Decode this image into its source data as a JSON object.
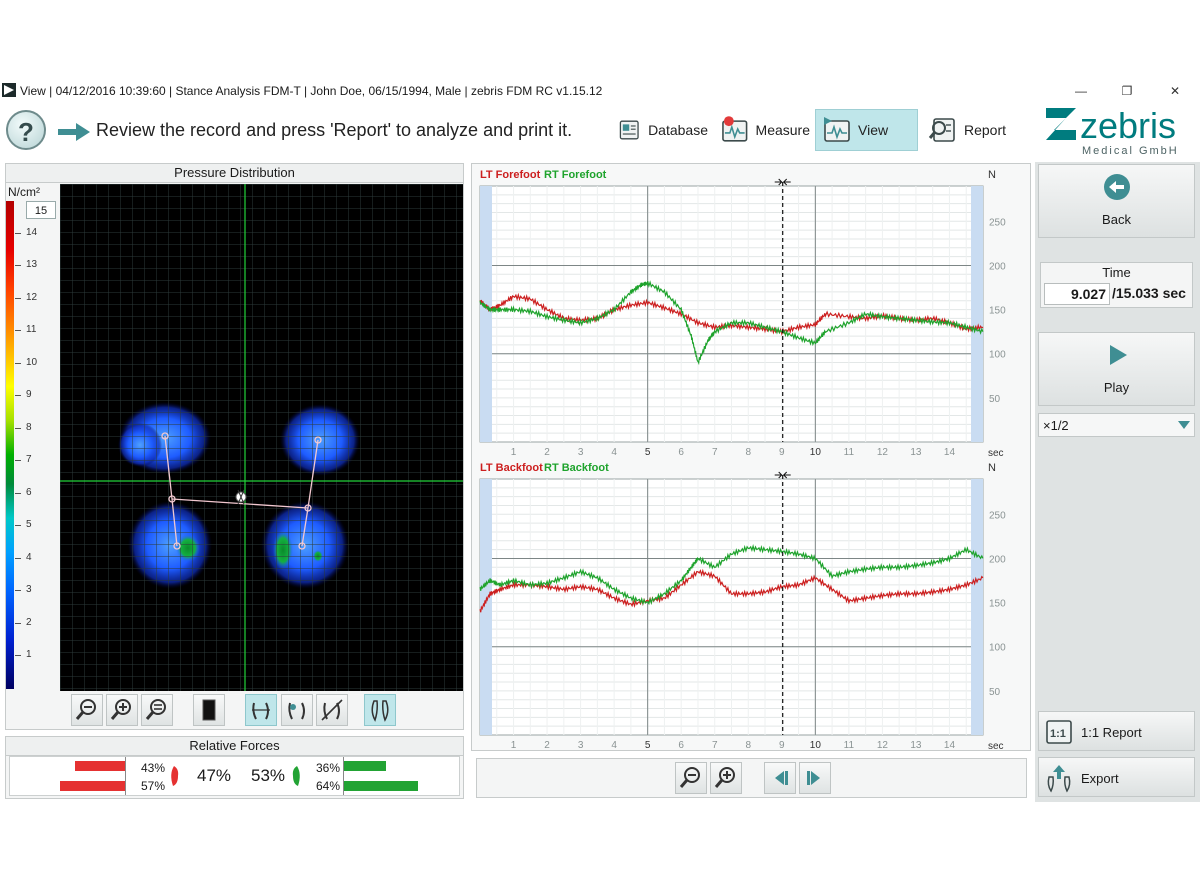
{
  "window": {
    "title": "View | 04/12/2016 10:39:60 | Stance Analysis FDM-T | John Doe, 06/15/1994, Male | zebris FDM RC v1.15.12",
    "min": "—",
    "restore": "❐",
    "close": "✕"
  },
  "toolbar": {
    "help": "?",
    "instruction": "Review the record and press 'Report' to analyze and print it.",
    "nav": [
      {
        "label": "Database",
        "icon": "database-icon"
      },
      {
        "label": "Measure",
        "icon": "measure-icon"
      },
      {
        "label": "View",
        "icon": "view-icon",
        "active": true
      },
      {
        "label": "Report",
        "icon": "report-icon"
      }
    ]
  },
  "logo": {
    "brand": "zebris",
    "subtitle": "Medical GmbH",
    "color": "#007c7f"
  },
  "pressure": {
    "title": "Pressure Distribution",
    "unit": "N/cm²",
    "max_box": "15",
    "scale_ticks": [
      "14",
      "13",
      "12",
      "11",
      "10",
      "9",
      "8",
      "7",
      "6",
      "5",
      "4",
      "3",
      "2",
      "1"
    ]
  },
  "forces": {
    "title": "Relative Forces",
    "left_fore": "43%",
    "left_back": "57%",
    "left_total": "47%",
    "right_total": "53%",
    "right_fore": "36%",
    "right_back": "64%",
    "left_color": "#e53131",
    "right_color": "#22a334"
  },
  "charts": {
    "forefoot": {
      "lt_label": "LT Forefoot",
      "rt_label": "RT Forefoot",
      "unit": "N",
      "xunit": "sec"
    },
    "backfoot": {
      "lt_label": "LT Backfoot",
      "rt_label": "RT Backfoot",
      "unit": "N",
      "xunit": "sec"
    }
  },
  "chart_data": [
    {
      "type": "line",
      "xlim": [
        0,
        15
      ],
      "ylim": [
        0,
        290
      ],
      "xticks": [
        1,
        2,
        3,
        4,
        5,
        6,
        7,
        8,
        9,
        10,
        11,
        12,
        13,
        14
      ],
      "yticks": [
        50,
        100,
        150,
        200,
        250
      ],
      "cursor_x": 9.027,
      "series": [
        {
          "name": "LT Forefoot",
          "color": "#cc1f1f",
          "x": [
            0,
            0.3,
            0.6,
            1,
            1.5,
            2,
            2.5,
            3,
            3.5,
            4,
            4.5,
            5,
            5.5,
            6,
            6.5,
            7,
            7.5,
            8,
            8.5,
            9,
            9.5,
            10,
            10.3,
            11,
            11.5,
            12,
            12.5,
            13,
            13.5,
            14,
            14.5,
            15
          ],
          "y": [
            160,
            150,
            155,
            165,
            162,
            150,
            140,
            138,
            140,
            150,
            155,
            158,
            152,
            145,
            135,
            130,
            132,
            130,
            128,
            125,
            130,
            133,
            145,
            142,
            140,
            143,
            140,
            138,
            140,
            135,
            128,
            130
          ]
        },
        {
          "name": "RT Forefoot",
          "color": "#1ea32c",
          "x": [
            0,
            0.3,
            0.6,
            1,
            1.5,
            2,
            2.5,
            3,
            3.5,
            4,
            4.5,
            4.8,
            5,
            5.5,
            6,
            6.3,
            6.5,
            6.8,
            7,
            7.5,
            8,
            8.5,
            9,
            9.5,
            10,
            10.3,
            11,
            11.5,
            12,
            12.5,
            13,
            13.5,
            14,
            14.5,
            15
          ],
          "y": [
            158,
            150,
            150,
            150,
            148,
            142,
            138,
            135,
            140,
            150,
            170,
            178,
            180,
            170,
            150,
            120,
            90,
            115,
            125,
            135,
            135,
            130,
            125,
            118,
            112,
            125,
            135,
            145,
            142,
            140,
            138,
            136,
            135,
            130,
            125
          ]
        }
      ]
    },
    {
      "type": "line",
      "xlim": [
        0,
        15
      ],
      "ylim": [
        0,
        290
      ],
      "xticks": [
        1,
        2,
        3,
        4,
        5,
        6,
        7,
        8,
        9,
        10,
        11,
        12,
        13,
        14
      ],
      "yticks": [
        50,
        100,
        150,
        200,
        250
      ],
      "cursor_x": 9.027,
      "series": [
        {
          "name": "LT Backfoot",
          "color": "#cc1f1f",
          "x": [
            0,
            0.3,
            0.6,
            1,
            1.5,
            2,
            2.5,
            3,
            3.5,
            4,
            4.5,
            5,
            5.5,
            6,
            6.5,
            7,
            7.5,
            8,
            8.5,
            9,
            9.5,
            10,
            10.5,
            11,
            11.5,
            12,
            12.5,
            13,
            13.5,
            14,
            14.5,
            15
          ],
          "y": [
            140,
            160,
            165,
            170,
            170,
            168,
            165,
            168,
            165,
            155,
            148,
            152,
            155,
            170,
            185,
            180,
            160,
            160,
            162,
            168,
            170,
            178,
            165,
            152,
            155,
            158,
            160,
            160,
            162,
            165,
            170,
            178
          ]
        },
        {
          "name": "RT Backfoot",
          "color": "#1ea32c",
          "x": [
            0,
            0.3,
            0.6,
            1,
            1.5,
            2,
            2.5,
            3,
            3.5,
            4,
            4.5,
            5,
            5.5,
            6,
            6.3,
            6.5,
            7,
            7.5,
            8,
            8.5,
            9,
            9.5,
            10,
            10.5,
            11,
            11.5,
            12,
            12.5,
            13,
            13.5,
            14,
            14.5,
            15
          ],
          "y": [
            165,
            175,
            170,
            175,
            170,
            172,
            178,
            185,
            178,
            165,
            155,
            150,
            160,
            175,
            190,
            200,
            190,
            205,
            212,
            210,
            208,
            205,
            200,
            180,
            185,
            188,
            190,
            190,
            192,
            195,
            200,
            210,
            200
          ]
        }
      ]
    }
  ],
  "side": {
    "back": "Back",
    "time_title": "Time",
    "time_current": "9.027",
    "time_total": "/15.033 sec",
    "play": "Play",
    "speed": "×1/2",
    "report11": "1:1 Report",
    "export": "Export"
  }
}
